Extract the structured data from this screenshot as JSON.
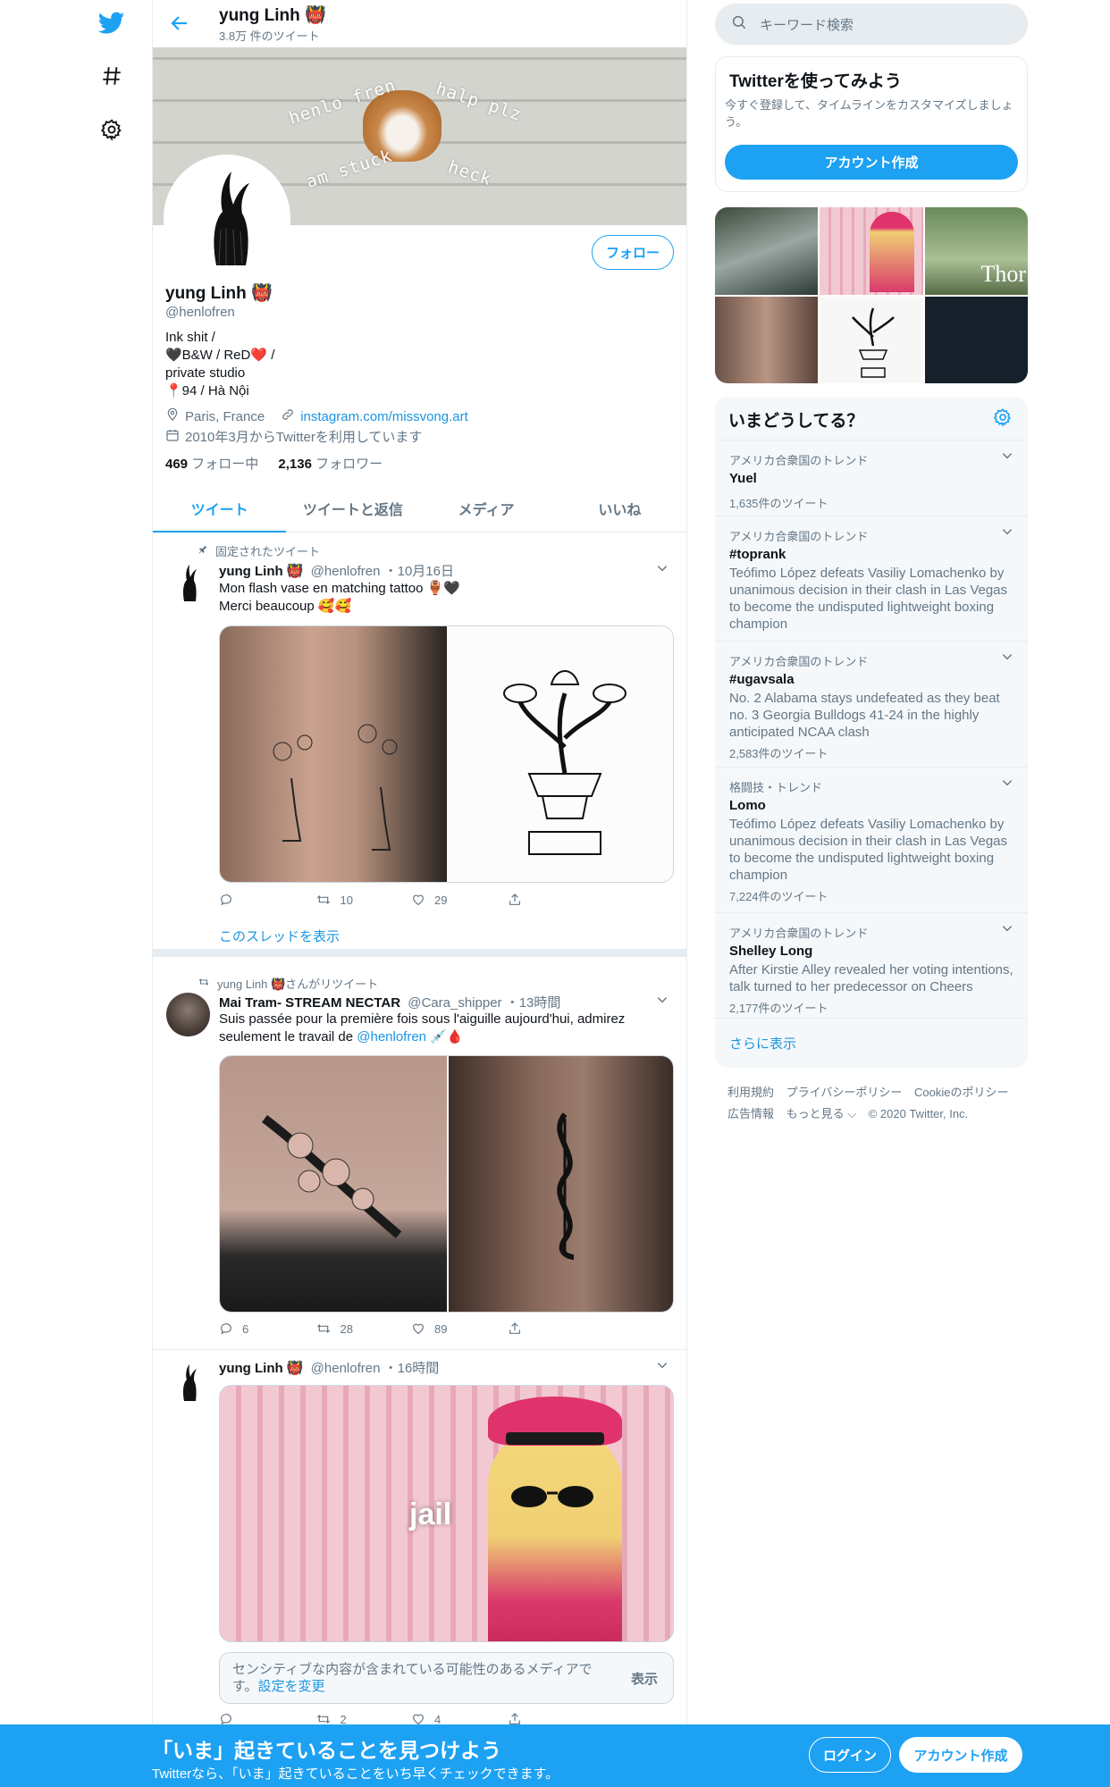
{
  "header": {
    "name": "yung Linh 👹",
    "tweet_count": "3.8万 件のツイート"
  },
  "banner": {
    "texts": [
      "henlo fren",
      "halp plz",
      "am stuck",
      "heck"
    ]
  },
  "profile": {
    "follow_label": "フォロー",
    "name": "yung Linh 👹",
    "handle": "@henlofren",
    "bio_lines": [
      "Ink shit /",
      "🖤B&W / ReD❤️ /",
      "private studio",
      "📍94 / Hà Nội"
    ],
    "location": "Paris, France",
    "website": "instagram.com/missvong.art",
    "joined": "2010年3月からTwitterを利用しています",
    "following_count": "469",
    "following_label": " フォロー中",
    "followers_count": "2,136",
    "followers_label": " フォロワー"
  },
  "tabs": [
    "ツイート",
    "ツイートと返信",
    "メディア",
    "いいね"
  ],
  "tweets": [
    {
      "context": "固定されたツイート",
      "name": "yung Linh 👹",
      "handle": "@henlofren",
      "time": "・10月16日",
      "text_line1": "Mon flash vase en matching tattoo 🏺🖤",
      "text_line2": "Merci beaucoup 🥰🥰",
      "reply_count": "",
      "retweet_count": "10",
      "like_count": "29",
      "thread_link": "このスレッドを表示"
    },
    {
      "context": "yung Linh 👹さんがリツイート",
      "name": "Mai Tram- STREAM NECTAR",
      "handle": "@Cara_shipper",
      "time": "・13時間",
      "text_line1": "Suis passée pour la première fois sous l'aiguille aujourd'hui, admirez",
      "text_line2_pre": "seulement le travail de ",
      "mention": "@henlofren",
      "text_line2_post": " 💉🩸",
      "reply_count": "6",
      "retweet_count": "28",
      "like_count": "89"
    },
    {
      "name": "yung Linh 👹",
      "handle": "@henlofren",
      "time": "・16時間",
      "media_caption": "jail",
      "sensitive_text": "センシティブな内容が含まれている可能性のあるメディアで",
      "sensitive_text2": "す。",
      "sensitive_link": "設定を変更",
      "sensitive_show": "表示",
      "retweet_count": "2",
      "like_count": "4"
    }
  ],
  "right": {
    "search_placeholder": "キーワード検索",
    "signup_card": {
      "title": "Twitterを使ってみよう",
      "desc": "今すぐ登録して、タイムラインをカスタマイズしましょう。",
      "button": "アカウント作成"
    },
    "media_grid_text": "Thor",
    "trends_title": "いまどうしてる？",
    "trends": [
      {
        "context": "アメリカ合衆国のトレンド",
        "name": "Yuel",
        "desc": "",
        "count": "1,635件のツイート"
      },
      {
        "context": "アメリカ合衆国のトレンド",
        "name": "#toprank",
        "desc": "Teófimo López defeats Vasiliy Lomachenko by unanimous decision in their clash in Las Vegas to become the undisputed lightweight boxing champion",
        "count": ""
      },
      {
        "context": "アメリカ合衆国のトレンド",
        "name": "#ugavsala",
        "desc": "No. 2 Alabama stays undefeated as they beat no. 3 Georgia Bulldogs 41-24 in the highly anticipated NCAA clash",
        "count": "2,583件のツイート"
      },
      {
        "context": "格闘技・トレンド",
        "name": "Lomo",
        "desc": "Teófimo López defeats Vasiliy Lomachenko by unanimous decision in their clash in Las Vegas to become the undisputed lightweight boxing champion",
        "count": "7,224件のツイート"
      },
      {
        "context": "アメリカ合衆国のトレンド",
        "name": "Shelley Long",
        "desc": "After Kirstie Alley revealed her voting intentions, talk turned to her predecessor on Cheers",
        "count": "2,177件のツイート"
      }
    ],
    "show_more": "さらに表示",
    "footer": [
      "利用規約",
      "プライバシーポリシー",
      "Cookieのポリシー",
      "広告情報",
      "もっと見る ⌵",
      "© 2020 Twitter, Inc."
    ]
  },
  "bottom_bar": {
    "title": "「いま」起きていることを見つけよう",
    "subtitle": "Twitterなら、「いま」起きていることをいち早くチェックできます。",
    "login": "ログイン",
    "signup": "アカウント作成"
  },
  "colors": {
    "accent": "#1da1f2",
    "link": "#1b95e0",
    "muted": "#657786"
  }
}
